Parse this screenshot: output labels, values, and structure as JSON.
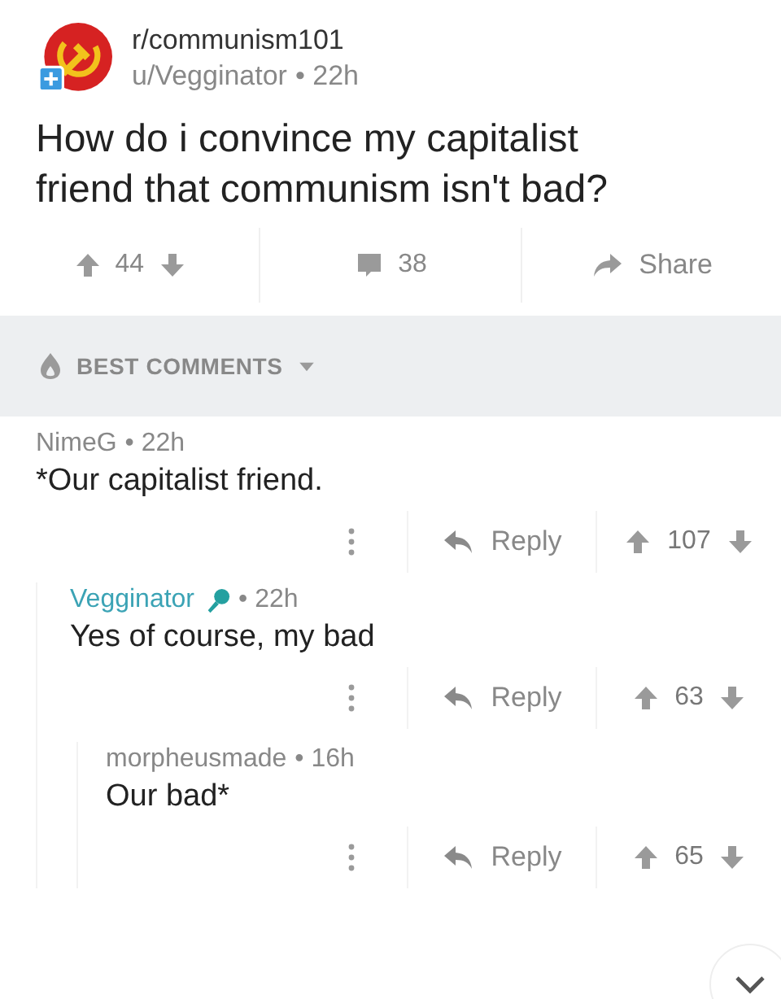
{
  "post": {
    "subreddit": "r/communism101",
    "author": "u/Vegginator",
    "age": "• 22h",
    "title": "How do i convince my capitalist friend that communism isn't bad?",
    "score": "44",
    "comments": "38",
    "share": "Share"
  },
  "sort": {
    "label": "BEST COMMENTS"
  },
  "comments": [
    {
      "author": "NimeG",
      "op": false,
      "age": "• 22h",
      "body": "*Our capitalist friend.",
      "reply": "Reply",
      "score": "107",
      "children": [
        {
          "author": "Vegginator",
          "op": true,
          "age": "• 22h",
          "body": "Yes of course, my bad",
          "reply": "Reply",
          "score": "63",
          "children": [
            {
              "author": "morpheusmade",
              "op": false,
              "age": "• 16h",
              "body": "Our bad*",
              "reply": "Reply",
              "score": "65"
            }
          ]
        }
      ]
    }
  ]
}
